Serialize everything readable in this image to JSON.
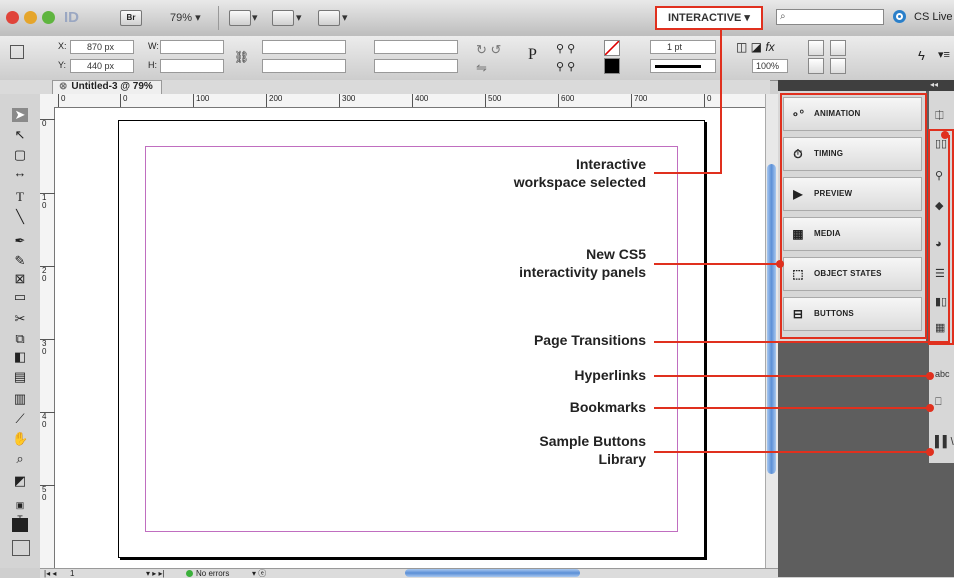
{
  "app": {
    "logo": "ID",
    "bridge": "Br",
    "zoom": "79%",
    "workspace": "INTERACTIVE",
    "cs_live": "CS Live"
  },
  "control": {
    "x": "870 px",
    "y": "440 px",
    "x_label": "X:",
    "y_label": "Y:",
    "w_label": "W:",
    "h_label": "H:",
    "stroke": "1 pt",
    "scale": "100%"
  },
  "document": {
    "tab": "Untitled-3 @ 79%"
  },
  "ruler": {
    "marks": [
      "0",
      "0",
      "100",
      "200",
      "300",
      "400",
      "500",
      "600",
      "700",
      "0"
    ],
    "vmarks": [
      "0",
      "1\n0",
      "2\n0",
      "3\n0",
      "4\n0",
      "5\n0"
    ]
  },
  "status": {
    "page": "1",
    "errors": "No errors"
  },
  "panels": [
    {
      "label": "ANIMATION",
      "icon": "animation-icon"
    },
    {
      "label": "TIMING",
      "icon": "timing-icon"
    },
    {
      "label": "PREVIEW",
      "icon": "preview-icon"
    },
    {
      "label": "MEDIA",
      "icon": "media-icon"
    },
    {
      "label": "OBJECT STATES",
      "icon": "object-states-icon"
    },
    {
      "label": "BUTTONS",
      "icon": "buttons-icon"
    }
  ],
  "callouts": {
    "workspace": [
      "Interactive",
      "workspace selected"
    ],
    "panels": [
      "New CS5",
      "interactivity panels"
    ],
    "transitions": "Page Transitions",
    "hyperlinks": "Hyperlinks",
    "bookmarks": "Bookmarks",
    "library": [
      "Sample Buttons",
      "Library"
    ]
  },
  "colors": {
    "callout": "#e0301e",
    "margin": "#c06ec0",
    "scroll": "#5b8fd6"
  }
}
